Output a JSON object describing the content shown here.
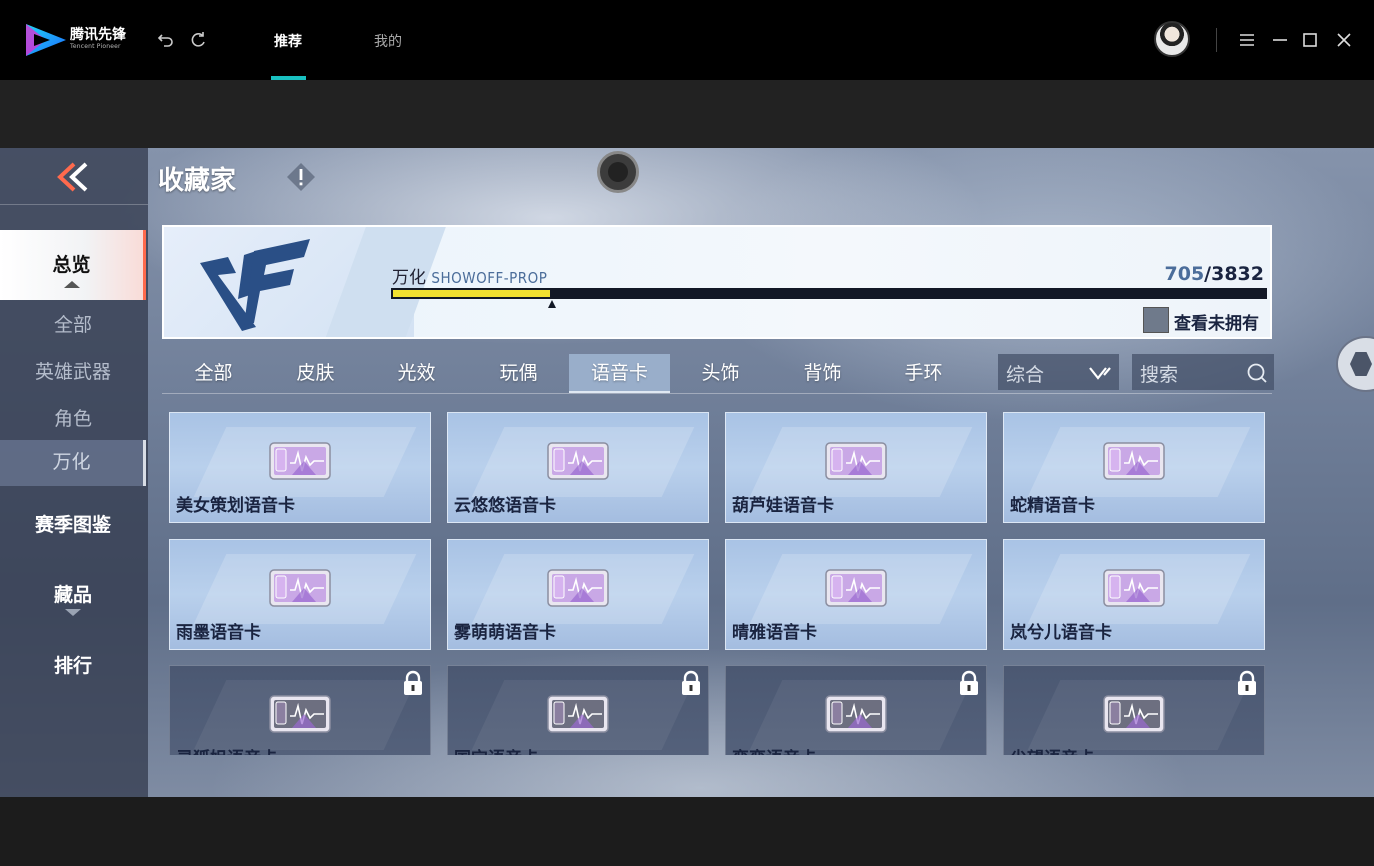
{
  "app": {
    "name_cn": "腾讯先锋",
    "name_en": "Tencent Pioneer"
  },
  "nav": {
    "tabs": [
      {
        "label": "推荐",
        "active": true
      },
      {
        "label": "我的",
        "active": false
      }
    ]
  },
  "game": {
    "title": "收藏家",
    "sidebar": {
      "items": [
        {
          "label": "总览"
        },
        {
          "label": "全部"
        },
        {
          "label": "英雄武器"
        },
        {
          "label": "角色"
        },
        {
          "label": "万化"
        },
        {
          "label": "赛季图鉴"
        },
        {
          "label": "藏品"
        },
        {
          "label": "排行"
        }
      ]
    },
    "progress": {
      "name": "万化",
      "name_en": "SHOWOFF-PROP",
      "current": "705",
      "total": "/3832",
      "fraction": 0.184
    },
    "show_unowned_label": "查看未拥有",
    "tabs": [
      "全部",
      "皮肤",
      "光效",
      "玩偶",
      "语音卡",
      "头饰",
      "背饰",
      "手环"
    ],
    "active_tab_index": 4,
    "sort": {
      "selected": "综合"
    },
    "search": {
      "placeholder": "搜索"
    },
    "cards": [
      {
        "name": "美女策划语音卡",
        "locked": false
      },
      {
        "name": "云悠悠语音卡",
        "locked": false
      },
      {
        "name": "葫芦娃语音卡",
        "locked": false
      },
      {
        "name": "蛇精语音卡",
        "locked": false
      },
      {
        "name": "雨墨语音卡",
        "locked": false
      },
      {
        "name": "雾萌萌语音卡",
        "locked": false
      },
      {
        "name": "晴雅语音卡",
        "locked": false
      },
      {
        "name": "岚兮儿语音卡",
        "locked": false
      },
      {
        "name": "灵狐姐语音卡",
        "locked": true
      },
      {
        "name": "国宝语音卡",
        "locked": true
      },
      {
        "name": "蛮蛮语音卡",
        "locked": true
      },
      {
        "name": "尖望语音卡",
        "locked": true
      }
    ]
  },
  "colors": {
    "accent_teal": "#19c1c1",
    "progress_yellow": "#f1e030",
    "active_marker": "#ff6a4d"
  }
}
